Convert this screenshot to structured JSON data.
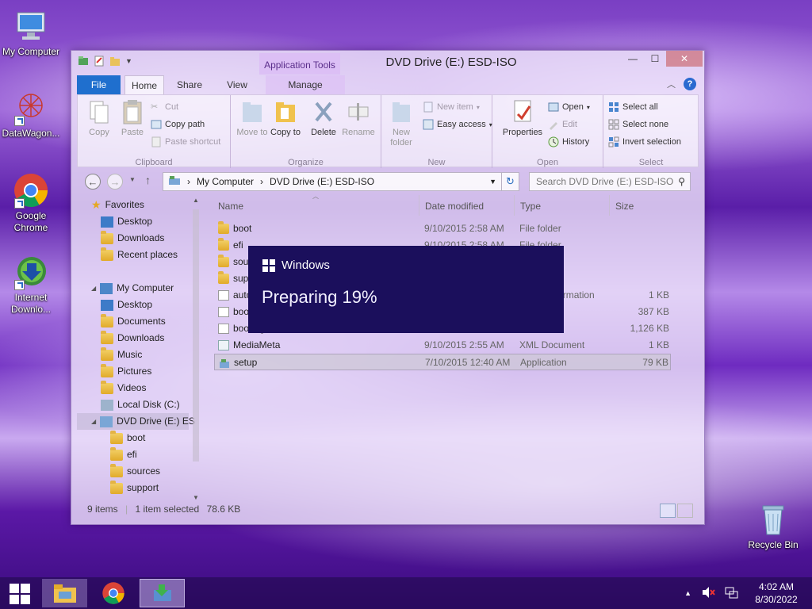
{
  "desktop": {
    "icons": [
      {
        "label": "My Computer"
      },
      {
        "label": "DataWagon..."
      },
      {
        "label": "Google Chrome"
      },
      {
        "label": "Internet Downlo..."
      },
      {
        "label": "Recycle Bin"
      }
    ]
  },
  "window": {
    "title": "DVD Drive (E:) ESD-ISO",
    "contextual_tab": "Application Tools",
    "tabs": {
      "file": "File",
      "home": "Home",
      "share": "Share",
      "view": "View",
      "manage": "Manage"
    },
    "controls": {
      "minimize": "—",
      "maximize": "☐",
      "close": "✕"
    }
  },
  "ribbon": {
    "clipboard": {
      "label": "Clipboard",
      "copy": "Copy",
      "paste": "Paste",
      "cut": "Cut",
      "copy_path": "Copy path",
      "paste_shortcut": "Paste shortcut"
    },
    "organize": {
      "label": "Organize",
      "move_to": "Move to",
      "copy_to": "Copy to",
      "delete": "Delete",
      "rename": "Rename"
    },
    "new": {
      "label": "New",
      "new_folder": "New folder",
      "new_item": "New item",
      "easy_access": "Easy access"
    },
    "open": {
      "label": "Open",
      "properties": "Properties",
      "open": "Open",
      "edit": "Edit",
      "history": "History"
    },
    "select": {
      "label": "Select",
      "select_all": "Select all",
      "select_none": "Select none",
      "invert_selection": "Invert selection"
    }
  },
  "address": {
    "breadcrumb": [
      "My Computer",
      "DVD Drive (E:) ESD-ISO"
    ],
    "search_placeholder": "Search DVD Drive (E:) ESD-ISO"
  },
  "nav": {
    "favorites": "Favorites",
    "fav_items": [
      "Desktop",
      "Downloads",
      "Recent places"
    ],
    "computer": "My Computer",
    "computer_items": [
      "Desktop",
      "Documents",
      "Downloads",
      "Music",
      "Pictures",
      "Videos",
      "Local Disk (C:)",
      "DVD Drive (E:) ES"
    ],
    "drive_children": [
      "boot",
      "efi",
      "sources",
      "support"
    ]
  },
  "files": {
    "columns": {
      "name": "Name",
      "date": "Date modified",
      "type": "Type",
      "size": "Size"
    },
    "rows": [
      {
        "name": "boot",
        "date": "9/10/2015 2:58 AM",
        "type": "File folder",
        "size": ""
      },
      {
        "name": "efi",
        "date": "9/10/2015 2:58 AM",
        "type": "File folder",
        "size": ""
      },
      {
        "name": "sources",
        "date": "",
        "type": "",
        "size": ""
      },
      {
        "name": "support",
        "date": "",
        "type": "",
        "size": ""
      },
      {
        "name": "autorun",
        "date": "",
        "type": "Setup Information",
        "size": "1 KB"
      },
      {
        "name": "bootmgr",
        "date": "",
        "type": "",
        "size": "387 KB"
      },
      {
        "name": "bootmgr.efi",
        "date": "",
        "type": "",
        "size": "1,126 KB"
      },
      {
        "name": "MediaMeta",
        "date": "9/10/2015 2:55 AM",
        "type": "XML Document",
        "size": "1 KB"
      },
      {
        "name": "setup",
        "date": "7/10/2015 12:40 AM",
        "type": "Application",
        "size": "79 KB"
      }
    ]
  },
  "status": {
    "items": "9 items",
    "selection": "1 item selected",
    "size": "78.6 KB"
  },
  "setup_dialog": {
    "brand": "Windows",
    "status": "Preparing 19%",
    "progress_percent": 19
  },
  "taskbar": {
    "time": "4:02 AM",
    "date": "8/30/2022"
  },
  "colors": {
    "dialog_bg": "#1b0f5c",
    "file_tab": "#1f6fce",
    "accent": "#2a6ad0"
  }
}
